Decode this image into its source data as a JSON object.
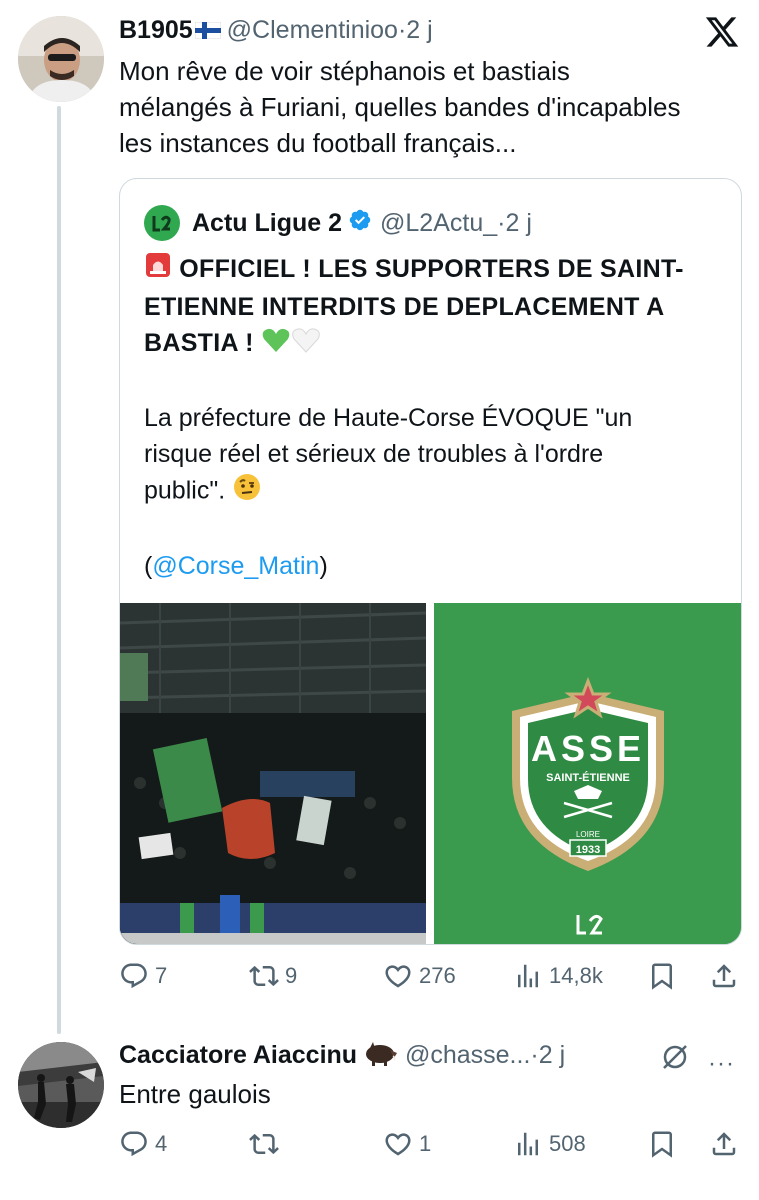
{
  "tweet1": {
    "name": "B1905",
    "handle": "@Clementinioo",
    "separator": "·",
    "time": "2 j",
    "text_lines": [
      "Mon rêve de voir stéphanois et bastiais",
      "mélangés à Furiani, quelles bandes d'incapables",
      "les instances du football français..."
    ],
    "actions": {
      "replies": "7",
      "retweets": "9",
      "likes": "276",
      "views": "14,8k"
    }
  },
  "quote": {
    "name": "Actu Ligue 2",
    "handle": "@L2Actu_",
    "separator": "·",
    "time": "2 j",
    "bold_lines": [
      "OFFICIEL ! LES SUPPORTERS DE SAINT-",
      "ETIENNE INTERDITS DE DEPLACEMENT A",
      "BASTIA !"
    ],
    "body_lines": [
      "La préfecture de Haute-Corse ÉVOQUE \"un",
      "risque réel et sérieux de troubles à l'ordre",
      "public\"."
    ],
    "paren_open": "(",
    "mention": "@Corse_Matin",
    "paren_close": ")",
    "crest": {
      "title": "ASSE",
      "subtitle": "SAINT-ÉTIENNE",
      "region": "LOIRE",
      "year": "1933"
    },
    "colors": {
      "green": "#3a9a4d",
      "link": "#1d9bf0"
    }
  },
  "tweet2": {
    "name": "Cacciatore Aiaccinu",
    "handle": "@chasse...",
    "separator": "·",
    "time": "2 j",
    "more": "···",
    "text": "Entre gaulois",
    "actions": {
      "replies": "4",
      "retweets": "",
      "likes": "1",
      "views": "508"
    }
  }
}
